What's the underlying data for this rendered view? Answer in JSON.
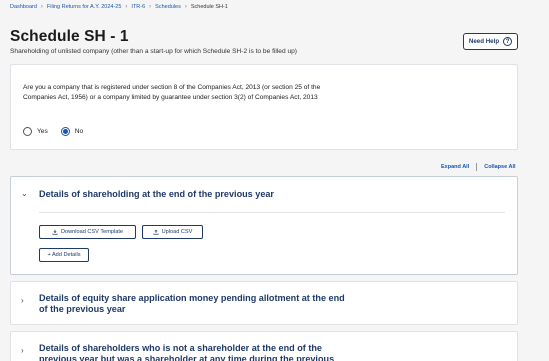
{
  "breadcrumb": {
    "items": [
      "Dashboard",
      "Filing Returns for A.Y. 2024-25",
      "ITR-6",
      "Schedules"
    ],
    "current": "Schedule SH-1",
    "separator": "›"
  },
  "header": {
    "title": "Schedule SH - 1",
    "subtitle": "Shareholding of unlisted company (other than a start-up for which Schedule SH-2 is to be filled up)",
    "need_help_label": "Need Help",
    "help_glyph": "?"
  },
  "question": {
    "text": "Are you a company that is registered under section 8 of the Companies Act, 2013 (or section 25 of the Companies Act, 1956) or a company limited by guarantee under section 3(2) of Companies Act, 2013",
    "options": [
      {
        "label": "Yes",
        "selected": false
      },
      {
        "label": "No",
        "selected": true
      }
    ]
  },
  "controls": {
    "expand_all": "Expand All",
    "collapse_all": "Collapse All"
  },
  "sections": [
    {
      "title": "Details of shareholding at the end of the previous year",
      "expanded": true,
      "chevron": "⌄",
      "download_label": "Download CSV Template",
      "upload_label": "Upload CSV",
      "add_label": "+ Add Details"
    },
    {
      "title": "Details of equity share application money pending allotment at the end of the previous year",
      "expanded": false,
      "chevron": "›"
    },
    {
      "title": "Details of shareholders who is not a shareholder at the end of the previous year but was a shareholder at any time during the previous year",
      "expanded": false,
      "chevron": "›"
    }
  ],
  "colors": {
    "accent": "#1a56a8",
    "heading_navy": "#1f3a67",
    "background": "#f5f5f6"
  }
}
